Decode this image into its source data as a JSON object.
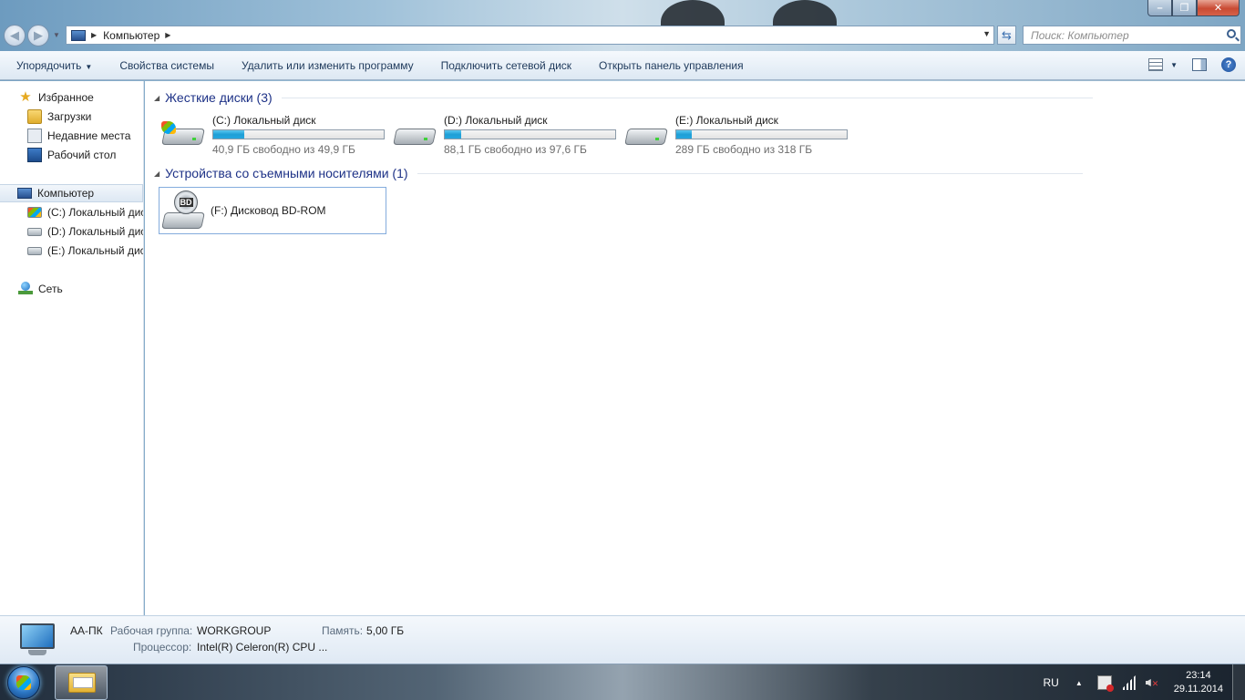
{
  "window": {
    "address": {
      "location": "Компьютер"
    },
    "search": {
      "placeholder": "Поиск: Компьютер"
    }
  },
  "toolbar": {
    "organize": "Упорядочить",
    "system_properties": "Свойства системы",
    "uninstall": "Удалить или изменить программу",
    "map_drive": "Подключить сетевой диск",
    "control_panel": "Открыть панель управления"
  },
  "nav": {
    "favorites": "Избранное",
    "downloads": "Загрузки",
    "recent": "Недавние места",
    "desktop": "Рабочий стол",
    "computer": "Компьютер",
    "drive_c": "(C:) Локальный диск",
    "drive_d": "(D:) Локальный диск",
    "drive_e": "(E:) Локальный диск",
    "network": "Сеть"
  },
  "content": {
    "hdd_header": "Жесткие диски (3)",
    "removable_header": "Устройства со съемными носителями (1)",
    "drives": [
      {
        "name": "(C:) Локальный диск",
        "free": "40,9 ГБ свободно из 49,9 ГБ",
        "used_fraction": 0.18
      },
      {
        "name": "(D:) Локальный диск",
        "free": "88,1 ГБ свободно из 97,6 ГБ",
        "used_fraction": 0.097
      },
      {
        "name": "(E:) Локальный диск",
        "free": "289 ГБ свободно из 318 ГБ",
        "used_fraction": 0.091
      }
    ],
    "bd_rom": {
      "name": "(F:) Дисковод BD-ROM",
      "label": "BD"
    }
  },
  "details": {
    "pc_name": "АА-ПК",
    "workgroup_label": "Рабочая группа:",
    "workgroup": "WORKGROUP",
    "memory_label": "Память:",
    "memory": "5,00 ГБ",
    "cpu_label": "Процессор:",
    "cpu": "Intel(R) Celeron(R) CPU ..."
  },
  "taskbar": {
    "lang": "RU",
    "time": "23:14",
    "date": "29.11.2014"
  },
  "icons": {
    "back": "back-arrow-icon",
    "forward": "forward-arrow-icon",
    "search": "magnifier-icon",
    "help": "question-mark-icon"
  }
}
